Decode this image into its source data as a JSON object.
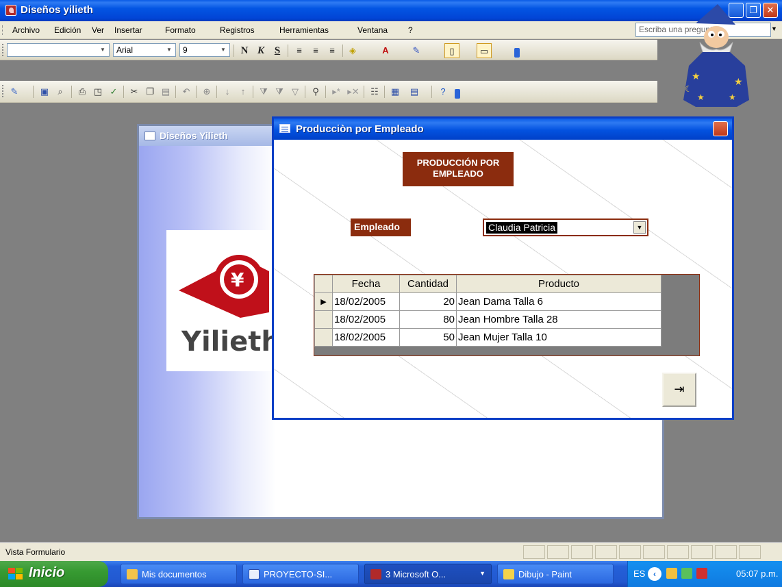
{
  "window": {
    "title": "Diseños yilieth"
  },
  "menu": {
    "items": [
      "Archivo",
      "Edición",
      "Ver",
      "Insertar",
      "Formato",
      "Registros",
      "Herramientas",
      "Ventana",
      "?"
    ],
    "ask_placeholder": "Escriba una pregunta"
  },
  "format_toolbar": {
    "object_value": "",
    "font": "Arial",
    "size": "9",
    "bold": "N",
    "italic": "K",
    "underline": "S"
  },
  "back_form": {
    "title": "Diseños Yilieth",
    "logo_text": "Yilieth"
  },
  "front_form": {
    "title": "Producciòn por Empleado",
    "header_label": "PRODUCCIÓN POR EMPLEADO",
    "employee_label": "Empleado",
    "employee_value": "Claudia Patricia",
    "columns": [
      "Fecha",
      "Cantidad",
      "Producto"
    ],
    "rows": [
      {
        "fecha": "18/02/2005",
        "cantidad": "20",
        "producto": "Jean Dama Talla 6"
      },
      {
        "fecha": "18/02/2005",
        "cantidad": "80",
        "producto": "Jean Hombre Talla 28"
      },
      {
        "fecha": "18/02/2005",
        "cantidad": "50",
        "producto": "Jean Mujer Talla 10"
      }
    ]
  },
  "status": {
    "text": "Vista Formulario"
  },
  "taskbar": {
    "start": "Inicio",
    "tasks": [
      "Mis documentos",
      "PROYECTO-SI...",
      "3 Microsoft O...",
      "Dibujo - Paint"
    ],
    "lang": "ES",
    "clock": "05:07 p.m."
  },
  "colors": {
    "form_accent": "#8b2c0e",
    "xp_blue": "#0355e3",
    "start_green": "#379a32"
  }
}
